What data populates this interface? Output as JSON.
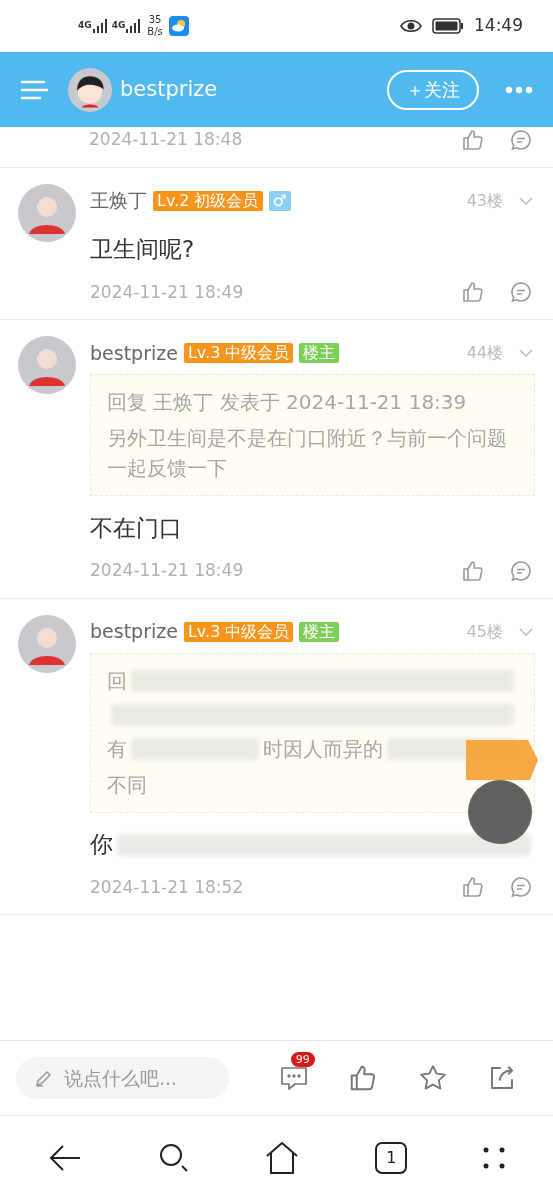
{
  "status_bar": {
    "network_1": "4G",
    "network_2": "4G",
    "speed_value": "35",
    "speed_unit": "B/s",
    "time": "14:49"
  },
  "header": {
    "username": "bestprize",
    "follow_label": "＋关注"
  },
  "posts": [
    {
      "partial": true,
      "date": "2024-11-21 18:48"
    },
    {
      "username": "王焕丁",
      "badges": [
        {
          "kind": "level",
          "text": "Lv.2 初级会员"
        },
        {
          "kind": "gender",
          "text": "♂"
        }
      ],
      "floor": "43楼",
      "content": [
        {
          "kind": "text",
          "text": "卫生间呢?"
        }
      ],
      "date": "2024-11-21 18:49"
    },
    {
      "username": "bestprize",
      "badges": [
        {
          "kind": "level",
          "text": "Lv.3 中级会员"
        },
        {
          "kind": "host",
          "text": "楼主"
        }
      ],
      "floor": "44楼",
      "quote": [
        [
          {
            "kind": "text",
            "text": "回复 王焕丁 发表于 2024-11-21 18:39"
          }
        ],
        [
          {
            "kind": "text",
            "text": "另外卫生间是不是在门口附近？与前一个问题一起反馈一下"
          }
        ]
      ],
      "content": [
        {
          "kind": "text",
          "text": "不在门口"
        }
      ],
      "date": "2024-11-21 18:49"
    },
    {
      "username": "bestprize",
      "badges": [
        {
          "kind": "level",
          "text": "Lv.3 中级会员"
        },
        {
          "kind": "host",
          "text": "楼主"
        }
      ],
      "floor": "45楼",
      "quote": [
        [
          {
            "kind": "text",
            "text": "回"
          },
          {
            "kind": "blur"
          }
        ],
        [
          {
            "kind": "blur"
          }
        ],
        [
          {
            "kind": "text",
            "text": "有"
          },
          {
            "kind": "blur"
          },
          {
            "kind": "text",
            "text": "时因人而异的"
          },
          {
            "kind": "blur"
          }
        ],
        [
          {
            "kind": "text",
            "text": "不同"
          }
        ]
      ],
      "content": [
        {
          "kind": "text",
          "text": "你"
        },
        {
          "kind": "blur"
        }
      ],
      "date": "2024-11-21 18:52"
    }
  ],
  "bottom_bar": {
    "placeholder": "说点什么吧...",
    "comment_count": "99"
  },
  "nav_bar": {
    "tab_count": "1"
  }
}
